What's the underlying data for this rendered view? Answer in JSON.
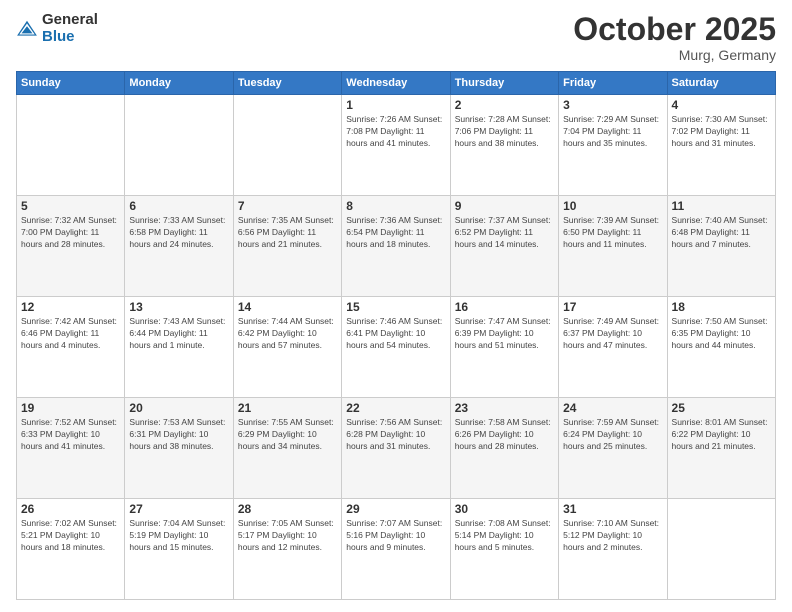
{
  "header": {
    "logo": {
      "general": "General",
      "blue": "Blue"
    },
    "title": "October 2025",
    "location": "Murg, Germany"
  },
  "weekdays": [
    "Sunday",
    "Monday",
    "Tuesday",
    "Wednesday",
    "Thursday",
    "Friday",
    "Saturday"
  ],
  "weeks": [
    [
      {
        "day": "",
        "info": ""
      },
      {
        "day": "",
        "info": ""
      },
      {
        "day": "",
        "info": ""
      },
      {
        "day": "1",
        "info": "Sunrise: 7:26 AM\nSunset: 7:08 PM\nDaylight: 11 hours and 41 minutes."
      },
      {
        "day": "2",
        "info": "Sunrise: 7:28 AM\nSunset: 7:06 PM\nDaylight: 11 hours and 38 minutes."
      },
      {
        "day": "3",
        "info": "Sunrise: 7:29 AM\nSunset: 7:04 PM\nDaylight: 11 hours and 35 minutes."
      },
      {
        "day": "4",
        "info": "Sunrise: 7:30 AM\nSunset: 7:02 PM\nDaylight: 11 hours and 31 minutes."
      }
    ],
    [
      {
        "day": "5",
        "info": "Sunrise: 7:32 AM\nSunset: 7:00 PM\nDaylight: 11 hours and 28 minutes."
      },
      {
        "day": "6",
        "info": "Sunrise: 7:33 AM\nSunset: 6:58 PM\nDaylight: 11 hours and 24 minutes."
      },
      {
        "day": "7",
        "info": "Sunrise: 7:35 AM\nSunset: 6:56 PM\nDaylight: 11 hours and 21 minutes."
      },
      {
        "day": "8",
        "info": "Sunrise: 7:36 AM\nSunset: 6:54 PM\nDaylight: 11 hours and 18 minutes."
      },
      {
        "day": "9",
        "info": "Sunrise: 7:37 AM\nSunset: 6:52 PM\nDaylight: 11 hours and 14 minutes."
      },
      {
        "day": "10",
        "info": "Sunrise: 7:39 AM\nSunset: 6:50 PM\nDaylight: 11 hours and 11 minutes."
      },
      {
        "day": "11",
        "info": "Sunrise: 7:40 AM\nSunset: 6:48 PM\nDaylight: 11 hours and 7 minutes."
      }
    ],
    [
      {
        "day": "12",
        "info": "Sunrise: 7:42 AM\nSunset: 6:46 PM\nDaylight: 11 hours and 4 minutes."
      },
      {
        "day": "13",
        "info": "Sunrise: 7:43 AM\nSunset: 6:44 PM\nDaylight: 11 hours and 1 minute."
      },
      {
        "day": "14",
        "info": "Sunrise: 7:44 AM\nSunset: 6:42 PM\nDaylight: 10 hours and 57 minutes."
      },
      {
        "day": "15",
        "info": "Sunrise: 7:46 AM\nSunset: 6:41 PM\nDaylight: 10 hours and 54 minutes."
      },
      {
        "day": "16",
        "info": "Sunrise: 7:47 AM\nSunset: 6:39 PM\nDaylight: 10 hours and 51 minutes."
      },
      {
        "day": "17",
        "info": "Sunrise: 7:49 AM\nSunset: 6:37 PM\nDaylight: 10 hours and 47 minutes."
      },
      {
        "day": "18",
        "info": "Sunrise: 7:50 AM\nSunset: 6:35 PM\nDaylight: 10 hours and 44 minutes."
      }
    ],
    [
      {
        "day": "19",
        "info": "Sunrise: 7:52 AM\nSunset: 6:33 PM\nDaylight: 10 hours and 41 minutes."
      },
      {
        "day": "20",
        "info": "Sunrise: 7:53 AM\nSunset: 6:31 PM\nDaylight: 10 hours and 38 minutes."
      },
      {
        "day": "21",
        "info": "Sunrise: 7:55 AM\nSunset: 6:29 PM\nDaylight: 10 hours and 34 minutes."
      },
      {
        "day": "22",
        "info": "Sunrise: 7:56 AM\nSunset: 6:28 PM\nDaylight: 10 hours and 31 minutes."
      },
      {
        "day": "23",
        "info": "Sunrise: 7:58 AM\nSunset: 6:26 PM\nDaylight: 10 hours and 28 minutes."
      },
      {
        "day": "24",
        "info": "Sunrise: 7:59 AM\nSunset: 6:24 PM\nDaylight: 10 hours and 25 minutes."
      },
      {
        "day": "25",
        "info": "Sunrise: 8:01 AM\nSunset: 6:22 PM\nDaylight: 10 hours and 21 minutes."
      }
    ],
    [
      {
        "day": "26",
        "info": "Sunrise: 7:02 AM\nSunset: 5:21 PM\nDaylight: 10 hours and 18 minutes."
      },
      {
        "day": "27",
        "info": "Sunrise: 7:04 AM\nSunset: 5:19 PM\nDaylight: 10 hours and 15 minutes."
      },
      {
        "day": "28",
        "info": "Sunrise: 7:05 AM\nSunset: 5:17 PM\nDaylight: 10 hours and 12 minutes."
      },
      {
        "day": "29",
        "info": "Sunrise: 7:07 AM\nSunset: 5:16 PM\nDaylight: 10 hours and 9 minutes."
      },
      {
        "day": "30",
        "info": "Sunrise: 7:08 AM\nSunset: 5:14 PM\nDaylight: 10 hours and 5 minutes."
      },
      {
        "day": "31",
        "info": "Sunrise: 7:10 AM\nSunset: 5:12 PM\nDaylight: 10 hours and 2 minutes."
      },
      {
        "day": "",
        "info": ""
      }
    ]
  ]
}
